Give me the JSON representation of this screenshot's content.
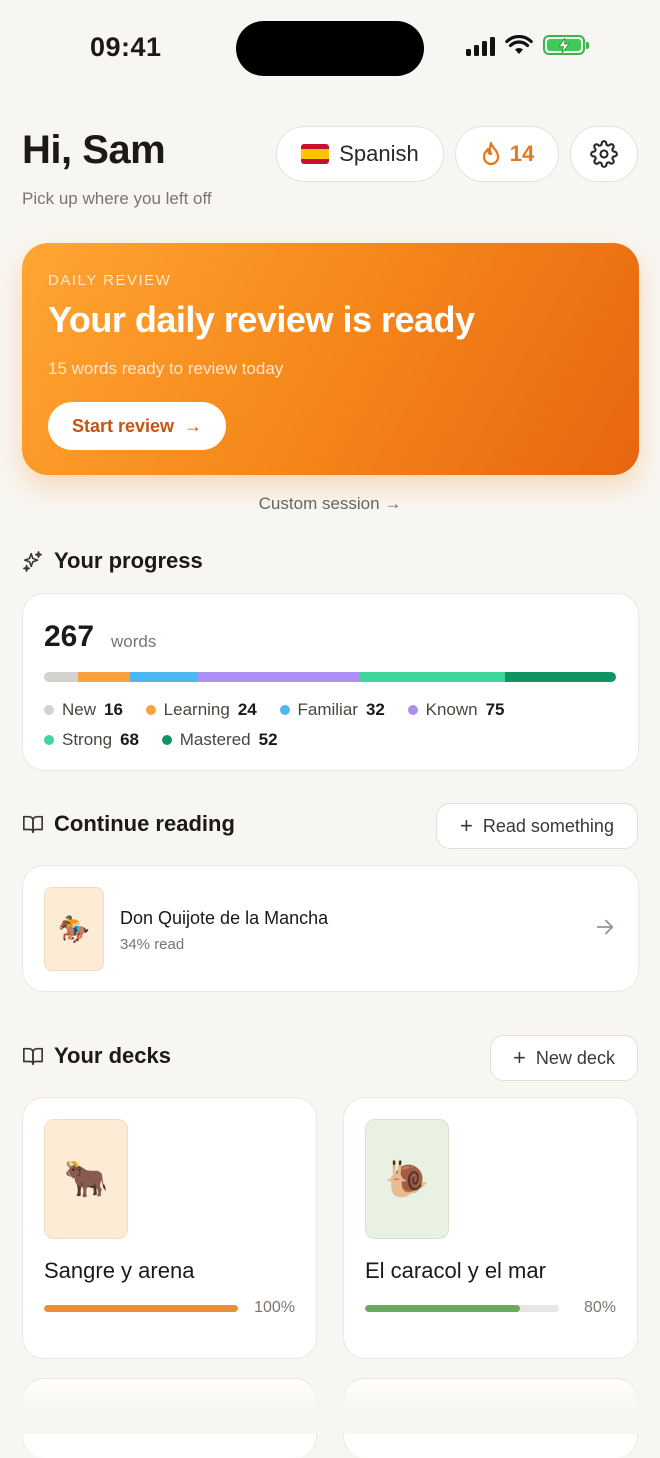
{
  "status": {
    "time": "09:41"
  },
  "header": {
    "greeting": "Hi, Sam",
    "subtitle": "Pick up where you left off",
    "language": "Spanish",
    "streak": "14"
  },
  "hero": {
    "eyebrow": "DAILY REVIEW",
    "title": "Your daily review is ready",
    "subtitle": "15 words ready to review today",
    "button": "Start review",
    "button_arrow": "→"
  },
  "custom_session": "Custom session →",
  "progress": {
    "title": "Your progress",
    "total": "267",
    "unit": "words",
    "levels": [
      {
        "label": "New",
        "count": "16",
        "value": 16,
        "color": "#d4d2cf"
      },
      {
        "label": "Learning",
        "count": "24",
        "value": 24,
        "color": "#f7a23b"
      },
      {
        "label": "Familiar",
        "count": "32",
        "value": 32,
        "color": "#4cb8f2"
      },
      {
        "label": "Known",
        "count": "75",
        "value": 75,
        "color": "#ab8ff2"
      },
      {
        "label": "Strong",
        "count": "68",
        "value": 68,
        "color": "#3fd69a"
      },
      {
        "label": "Mastered",
        "count": "52",
        "value": 52,
        "color": "#119463"
      }
    ]
  },
  "reading": {
    "title": "Continue reading",
    "action": "Read something",
    "book": {
      "title": "Don Quijote de la Mancha",
      "progress": "34% read",
      "emoji": "🏇"
    }
  },
  "decks": {
    "title": "Your decks",
    "action": "New deck",
    "items": [
      {
        "title": "Sangre y arena",
        "percent": "100%",
        "progress": 1.0,
        "emoji": "🐂",
        "bar_color": "#e98f3a",
        "thumb_bg": "#fdebd5",
        "thumb_border": "#f2dcc2"
      },
      {
        "title": "El caracol y el mar",
        "percent": "80%",
        "progress": 0.8,
        "emoji": "🐌",
        "bar_color": "#6aaa5c",
        "thumb_bg": "#e8f1e2",
        "thumb_border": "#d3e3c9"
      }
    ]
  }
}
